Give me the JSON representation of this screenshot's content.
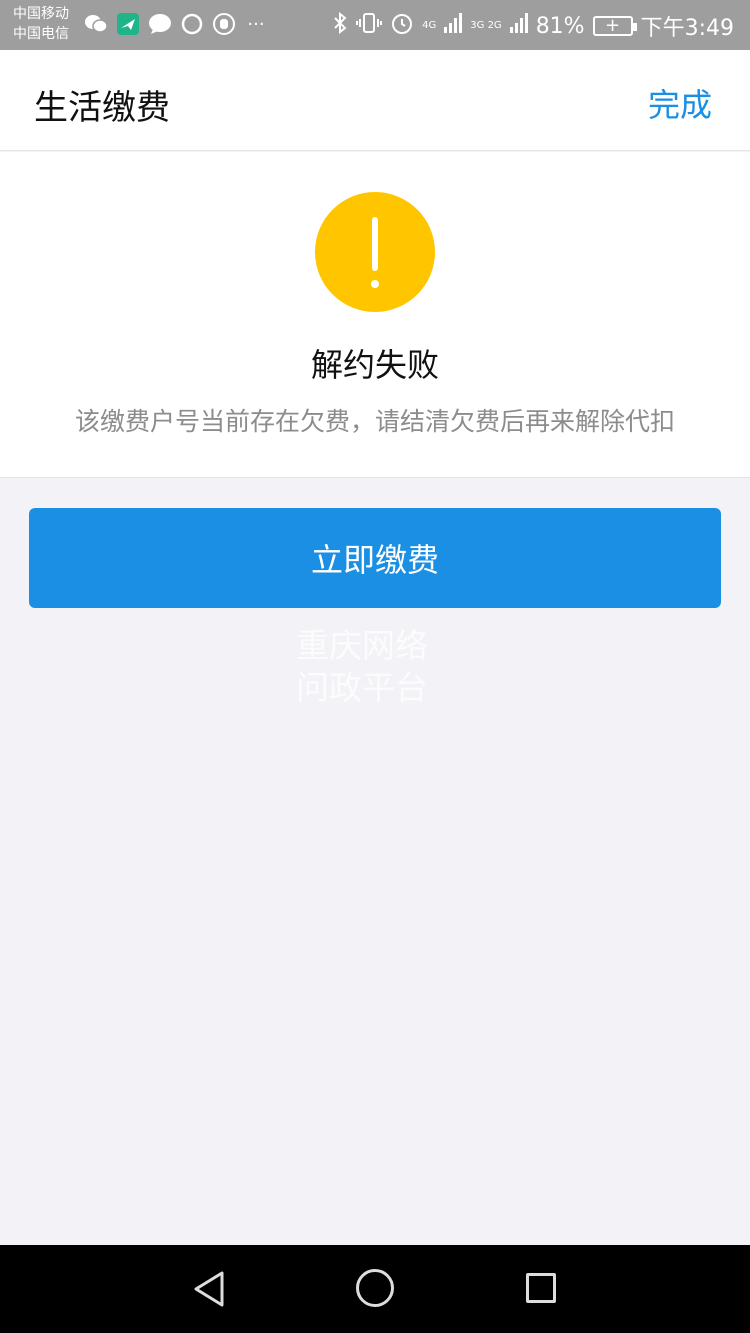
{
  "status_bar": {
    "carrier_1": "中国移动",
    "carrier_2": "中国电信",
    "left_icons": [
      "wechat-icon",
      "sent-app-icon",
      "message-icon",
      "circle-icon",
      "hand-icon",
      "more-icon"
    ],
    "more": "···",
    "network_1": "4G",
    "network_2": "3G 2G",
    "battery_percent": "81%",
    "time": "下午3:49"
  },
  "header": {
    "title": "生活缴费",
    "done_label": "完成"
  },
  "result": {
    "icon": "warning-icon",
    "icon_color": "#ffc600",
    "heading": "解约失败",
    "description": "该缴费户号当前存在欠费，请结清欠费后再来解除代扣"
  },
  "actions": {
    "pay_now_label": "立即缴费",
    "button_color": "#1a8fe3"
  },
  "watermark": {
    "line_1": "重庆网络",
    "line_2": "问政平台"
  },
  "nav_bar": {
    "back_icon": "back-triangle-icon",
    "home_icon": "home-circle-icon",
    "recent_icon": "recent-apps-square-icon"
  }
}
